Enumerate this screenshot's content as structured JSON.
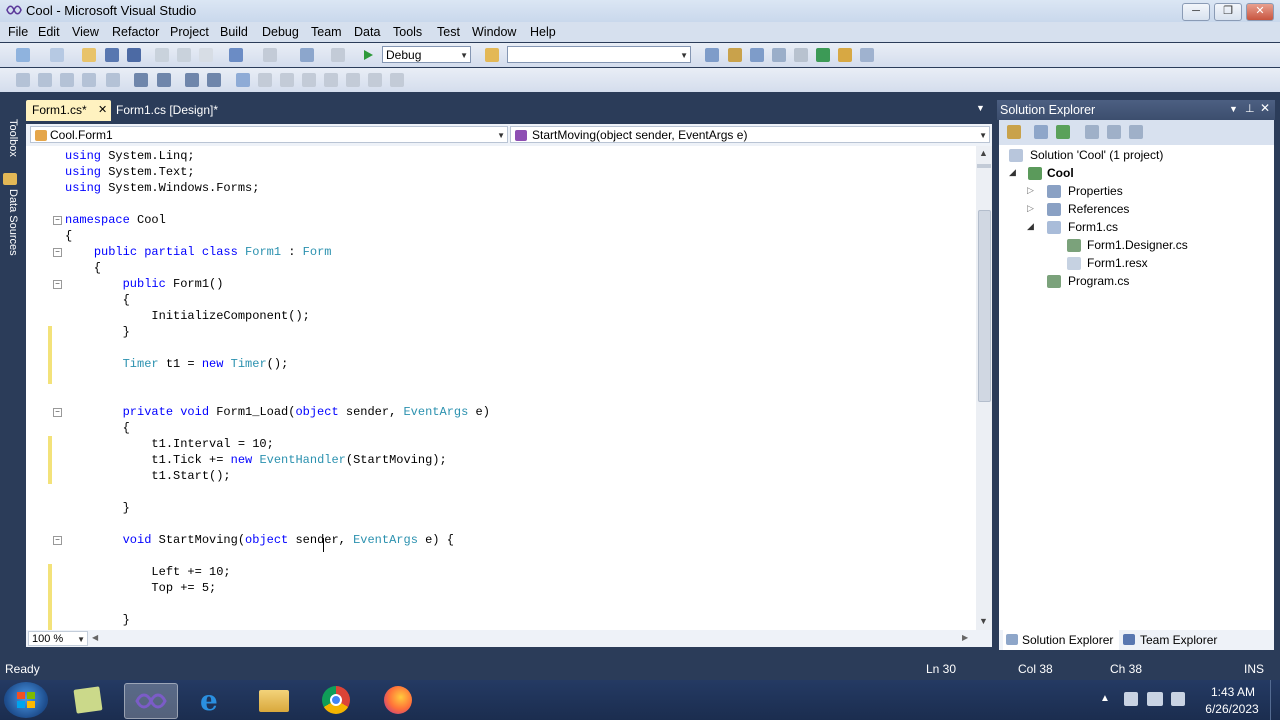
{
  "window": {
    "title": "Cool - Microsoft Visual Studio"
  },
  "menu": [
    "File",
    "Edit",
    "View",
    "Refactor",
    "Project",
    "Build",
    "Debug",
    "Team",
    "Data",
    "Tools",
    "Test",
    "Window",
    "Help"
  ],
  "toolbar": {
    "config": "Debug",
    "platform": ""
  },
  "side_tabs": [
    "Toolbox",
    "Data Sources"
  ],
  "doc_tabs": [
    {
      "label": "Form1.cs*",
      "active": true
    },
    {
      "label": "Form1.cs [Design]*",
      "active": false
    }
  ],
  "navbar": {
    "type": "Cool.Form1",
    "member": "StartMoving(object sender, EventArgs e)"
  },
  "code": [
    "using System.Linq;",
    "using System.Text;",
    "using System.Windows.Forms;",
    "",
    "namespace Cool",
    "{",
    "    public partial class Form1 : Form",
    "    {",
    "        public Form1()",
    "        {",
    "            InitializeComponent();",
    "        }",
    "",
    "        Timer t1 = new Timer();",
    "",
    "",
    "        private void Form1_Load(object sender, EventArgs e)",
    "        {",
    "            t1.Interval = 10;",
    "            t1.Tick += new EventHandler(StartMoving);",
    "            t1.Start();",
    "",
    "        }",
    "",
    "        void StartMoving(object sender, EventArgs e) {",
    "",
    "            Left += 10;",
    "            Top += 5;",
    "",
    "        }"
  ],
  "zoom": "100 %",
  "solution_explorer": {
    "title": "Solution Explorer",
    "items": [
      {
        "label": "Solution 'Cool' (1 project)",
        "level": 0
      },
      {
        "label": "Cool",
        "level": 1
      },
      {
        "label": "Properties",
        "level": 2
      },
      {
        "label": "References",
        "level": 2
      },
      {
        "label": "Form1.cs",
        "level": 2
      },
      {
        "label": "Form1.Designer.cs",
        "level": 3
      },
      {
        "label": "Form1.resx",
        "level": 3
      },
      {
        "label": "Program.cs",
        "level": 2
      }
    ],
    "bottom_tabs": [
      "Solution Explorer",
      "Team Explorer"
    ]
  },
  "status": {
    "text": "Ready",
    "ln": "Ln 30",
    "col": "Col 38",
    "ch": "Ch 38",
    "mode": "INS"
  },
  "taskbar": {
    "time": "1:43 AM",
    "date": "6/26/2023"
  }
}
